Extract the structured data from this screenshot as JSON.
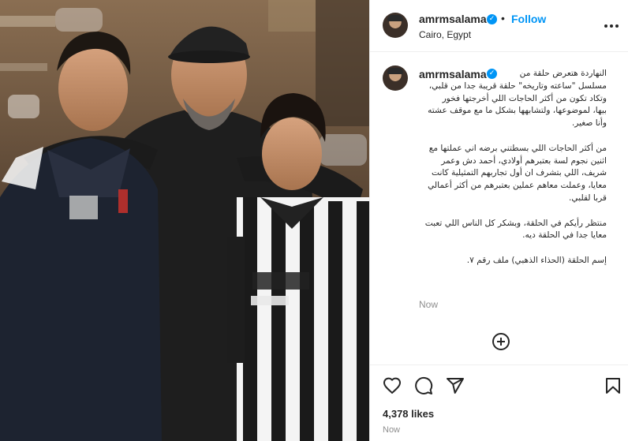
{
  "post": {
    "username": "amrmsalama",
    "follow_label": "Follow",
    "separator": "•",
    "location": "Cairo, Egypt",
    "verified_glyph": "✓"
  },
  "caption": {
    "username": "amrmsalama",
    "lines": [
      "النهاردة هتعرض حلقة من",
      "مسلسل \"ساعته وتاريخه\" حلقة قريبة جدا من قلبي،",
      "وتكاد تكون من أكثر الحاجات اللي أخرجتها فخور",
      "بيها، لموضوعها، ولتشابهها بشكل ما مع موقف عشته",
      "وأنا صغير.",
      "",
      "من أكثر الحاجات اللي بسطتني برضه اني عملتها مع",
      "اثنين نجوم لسة بعتبرهم أولادي، أحمد دش وعمر",
      "شريف، اللي بتشرف ان أول تجاربهم التمثيلية كانت",
      "معايا، وعملت معاهم عملين بعتبرهم من أكثر أعمالي",
      "قربا لقلبي.",
      "",
      "منتظر رأيكم في الحلقة، وبشكر كل الناس اللي تعبت",
      "معايا جدا في الحلقة ديه.",
      "",
      "إسم الحلقة (الحذاء الذهبي) ملف رقم ٧."
    ],
    "time": "Now"
  },
  "engagement": {
    "likes": "4,378 likes",
    "time": "Now"
  },
  "icons": {
    "more": "more-options-icon",
    "load_more": "plus-circle-icon",
    "like": "heart-icon",
    "comment": "comment-icon",
    "share": "send-icon",
    "save": "bookmark-icon"
  },
  "colors": {
    "accent": "#0095f6",
    "text": "#262626",
    "muted": "#8e8e8e",
    "border": "#efefef"
  }
}
